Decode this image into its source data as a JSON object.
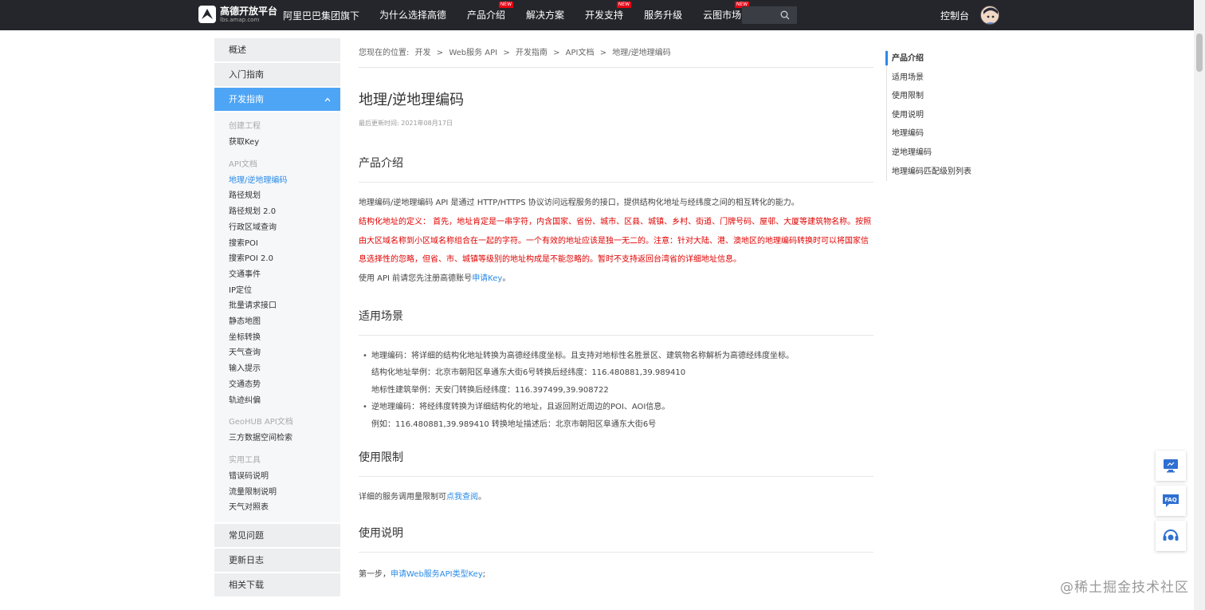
{
  "header": {
    "logo_title": "高德开放平台",
    "logo_sub": "lbs.amap.com",
    "alibaba": "阿里巴巴集团旗下",
    "nav": [
      {
        "label": "为什么选择高德",
        "new": false
      },
      {
        "label": "产品介绍",
        "new": true
      },
      {
        "label": "解决方案",
        "new": false
      },
      {
        "label": "开发支持",
        "new": true
      },
      {
        "label": "服务升级",
        "new": false
      },
      {
        "label": "云图市场",
        "new": true
      }
    ],
    "new_badge": "NEW",
    "search_placeholder": "",
    "console": "控制台"
  },
  "sidebar": {
    "overview": "概述",
    "getting_started": "入门指南",
    "dev_guide": "开发指南",
    "group_create": "创建工程",
    "get_key": "获取Key",
    "group_api": "API文档",
    "api_links": [
      "地理/逆地理编码",
      "路径规划",
      "路径规划 2.0",
      "行政区域查询",
      "搜索POI",
      "搜索POI 2.0",
      "交通事件",
      "IP定位",
      "批量请求接口",
      "静态地图",
      "坐标转换",
      "天气查询",
      "输入提示",
      "交通态势",
      "轨迹纠偏"
    ],
    "group_geohub": "GeoHUB API文档",
    "geohub_links": [
      "三方数据空间检索"
    ],
    "group_tools": "实用工具",
    "tool_links": [
      "错误码说明",
      "流量限制说明",
      "天气对照表"
    ],
    "faq": "常见问题",
    "changelog": "更新日志",
    "downloads": "相关下载"
  },
  "content": {
    "breadcrumb_prefix": "您现在的位置:",
    "breadcrumb": [
      "开发",
      ">",
      "Web服务 API",
      ">",
      "开发指南",
      ">",
      "API文档",
      ">",
      "地理/逆地理编码"
    ],
    "title": "地理/逆地理编码",
    "updated": "最后更新时间: 2021年08月17日",
    "sec1_title": "产品介绍",
    "sec1_para": "地理编码/逆地理编码 API 是通过 HTTP/HTTPS 协议访问远程服务的接口，提供结构化地址与经纬度之间的相互转化的能力。",
    "sec1_red": "结构化地址的定义： 首先，地址肯定是一串字符，内含国家、省份、城市、区县、城镇、乡村、街道、门牌号码、屋邨、大厦等建筑物名称。按照由大区域名称到小区域名称组合在一起的字符。一个有效的地址应该是独一无二的。注意：针对大陆、港、澳地区的地理编码转换时可以将国家信息选择性的忽略，但省、市、城镇等级别的地址构成是不能忽略的。暂时不支持返回台湾省的详细地址信息。",
    "sec1_note_pre": "使用 API 前请您先注册高德账号",
    "sec1_note_link": "申请Key",
    "sec1_note_post": "。",
    "sec2_title": "适用场景",
    "b1": "地理编码：将详细的结构化地址转换为高德经纬度坐标。且支持对地标性名胜景区、建筑物名称解析为高德经纬度坐标。",
    "b1_ex1": "结构化地址举例：北京市朝阳区阜通东大街6号转换后经纬度：116.480881,39.989410",
    "b1_ex2": "地标性建筑举例：天安门转换后经纬度：116.397499,39.908722",
    "b2": "逆地理编码：将经纬度转换为详细结构化的地址，且返回附近周边的POI、AOI信息。",
    "b2_ex": "例如：116.480881,39.989410 转换地址描述后：北京市朝阳区阜通东大街6号",
    "sec3_title": "使用限制",
    "sec3_pre": "详细的服务调用量限制可",
    "sec3_link": "点我查阅",
    "sec3_post": "。",
    "sec4_title": "使用说明",
    "sec4_pre": "第一步，",
    "sec4_link": "申请Web服务API类型Key",
    "sec4_post": ";"
  },
  "toc": [
    "产品介绍",
    "适用场景",
    "使用限制",
    "使用说明",
    "地理编码",
    "逆地理编码",
    "地理编码匹配级别列表"
  ],
  "float_buttons": [
    "monitor-icon",
    "faq-icon",
    "support-icon"
  ],
  "watermark": "@稀土掘金技术社区",
  "colors": {
    "accent": "#2a8ae8",
    "active_nav": "#4ea5f5",
    "warning": "#e00000",
    "topbar": "#24262b"
  }
}
